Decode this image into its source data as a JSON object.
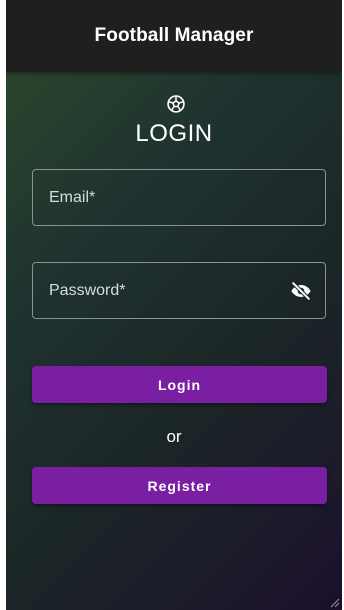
{
  "app": {
    "title": "Football Manager"
  },
  "login_form": {
    "heading": "LOGIN",
    "heading_icon": "soccer-ball-icon",
    "email": {
      "placeholder": "Email*",
      "value": ""
    },
    "password": {
      "placeholder": "Password*",
      "value": "",
      "visibility_icon": "eye-off-icon"
    },
    "login_label": "Login",
    "or_label": "or",
    "register_label": "Register"
  },
  "colors": {
    "appbar": "#1f1f1f",
    "button": "#7b1fa2",
    "text": "#ffffff"
  }
}
